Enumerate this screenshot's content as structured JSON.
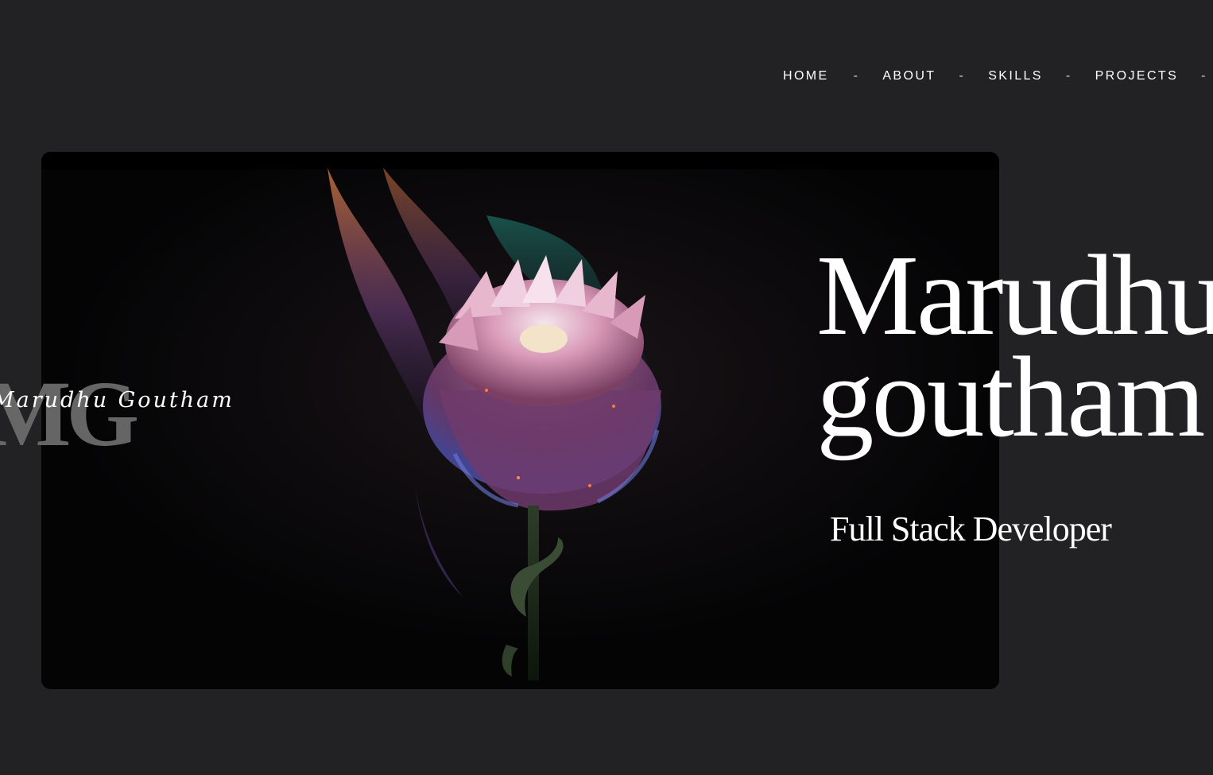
{
  "nav": {
    "items": [
      {
        "label": "HOME"
      },
      {
        "label": "ABOUT"
      },
      {
        "label": "SKILLS"
      },
      {
        "label": "PROJECTS"
      }
    ],
    "separator": "-"
  },
  "logo": {
    "monogram": "MG",
    "script": "Marudhu Goutham"
  },
  "hero": {
    "name_line1": "Marudhu",
    "name_line2": "goutham",
    "role": "Full Stack Developer"
  },
  "colors": {
    "background": "#222224",
    "image_background": "#040405",
    "text": "#ffffff",
    "monogram": "#6b6b6b"
  }
}
